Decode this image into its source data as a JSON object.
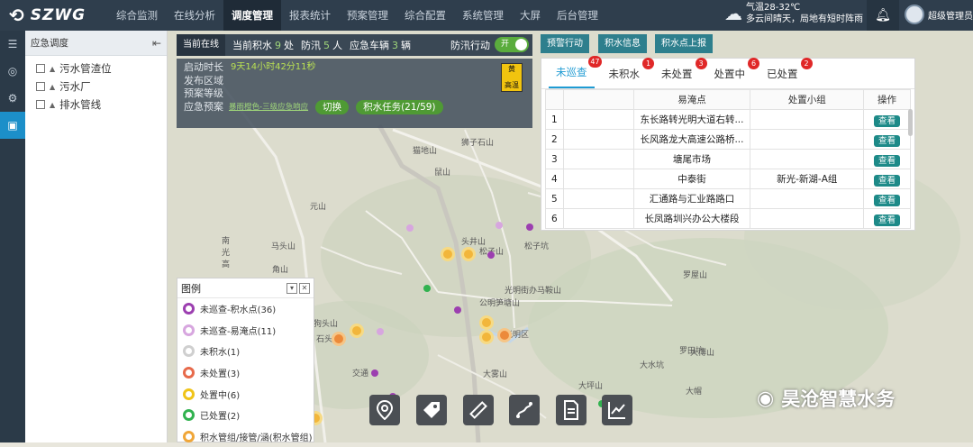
{
  "topbar": {
    "logo": "SZWG",
    "nav": [
      "综合监测",
      "在线分析",
      "调度管理",
      "报表统计",
      "预案管理",
      "综合配置",
      "系统管理",
      "大屏",
      "后台管理"
    ],
    "active_nav": "调度管理",
    "weather_temp": "气温28-32℃",
    "weather_desc": "多云间晴天，局地有短时阵雨",
    "user": "超级管理员"
  },
  "tree": {
    "title": "应急调度",
    "items": [
      "污水管渣位",
      "污水厂",
      "排水管线"
    ]
  },
  "statusbar": {
    "label": "当前在线",
    "water_prefix": "当前积水",
    "water_count": "9",
    "water_unit": "处",
    "flood_prefix": "防汛",
    "flood_count": "5",
    "flood_unit": "人",
    "vehicle_prefix": "应急车辆",
    "vehicle_count": "3",
    "vehicle_unit": "辆",
    "action_label": "防汛行动",
    "toggle": "开"
  },
  "info": {
    "start_label": "启动时长",
    "start_value": "9天14小时42分11秒",
    "area_label": "发布区域",
    "plan_label": "预案等级",
    "warn_label": "应急预案",
    "warn_link": "暴雨橙色-三级应急响应",
    "switch_btn": "切换",
    "task_btn": "积水任务(21/59)",
    "badge_top": "黄",
    "badge_bottom": "高温"
  },
  "actions": [
    "预警行动",
    "积水信息",
    "积水点上报"
  ],
  "tabs": [
    {
      "label": "未巡查",
      "badge": "47"
    },
    {
      "label": "未积水",
      "badge": "1"
    },
    {
      "label": "未处置",
      "badge": "3"
    },
    {
      "label": "处置中",
      "badge": "6"
    },
    {
      "label": "已处置",
      "badge": "2"
    }
  ],
  "table": {
    "headers": [
      "",
      "易淹点",
      "处置小组",
      "操作"
    ],
    "rows": [
      {
        "no": "1",
        "point": "东长路转光明大道右转...",
        "group": "",
        "op": "查看"
      },
      {
        "no": "2",
        "point": "长风路龙大高速公路桥...",
        "group": "",
        "op": "查看"
      },
      {
        "no": "3",
        "point": "塘尾市场",
        "group": "",
        "op": "查看"
      },
      {
        "no": "4",
        "point": "中泰街",
        "group": "新光-新湖-A组",
        "op": "查看"
      },
      {
        "no": "5",
        "point": "汇通路与汇业路路口",
        "group": "",
        "op": "查看"
      },
      {
        "no": "6",
        "point": "长凤路圳兴办公大楼段",
        "group": "",
        "op": "查看"
      }
    ]
  },
  "legend": {
    "title": "图例",
    "items": [
      {
        "label": "未巡查-积水点(36)",
        "color": "#9c3fb0"
      },
      {
        "label": "未巡查-易淹点(11)",
        "color": "#d7a6df"
      },
      {
        "label": "未积水(1)",
        "color": "#cfcfcf"
      },
      {
        "label": "未处置(3)",
        "color": "#e76a4b"
      },
      {
        "label": "处置中(6)",
        "color": "#f0c419"
      },
      {
        "label": "已处置(2)",
        "color": "#31b24f"
      },
      {
        "label": "积水管组/接管/涵(积水管组)",
        "color": "#f0a638"
      }
    ]
  },
  "map_labels": [
    "狮子石山",
    "猫地山",
    "鼠山",
    "元山",
    "马头山",
    "角山",
    "头井山",
    "松子山",
    "松子坑",
    "光明街办马鞍山",
    "公明笋塘山",
    "狗头山",
    "大雾山",
    "罗屋山",
    "大水坑",
    "大博山",
    "南光高",
    "交通",
    "罗田坑",
    "大帽",
    "光明区",
    "大坪山",
    "石头山"
  ],
  "watermark": "昊沧智慧水务"
}
